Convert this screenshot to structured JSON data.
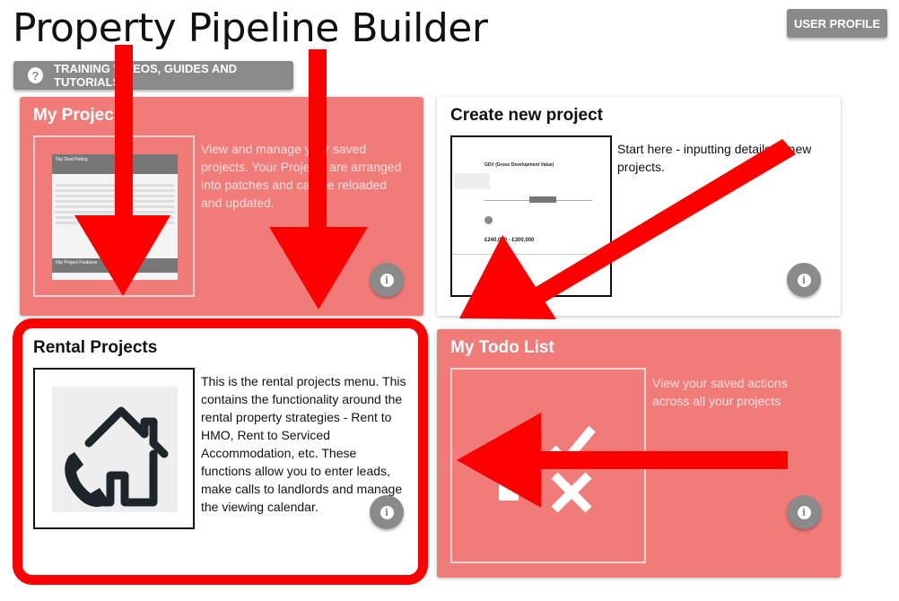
{
  "header": {
    "title": "Property Pipeline Builder",
    "user_profile_label": "USER PROFILE",
    "training_label": "TRAINING VIDEOS, GUIDES AND TUTORIALS",
    "help_glyph": "?"
  },
  "cards": {
    "my_projects": {
      "title": "My Projects",
      "description": "View and manage your saved projects. Your Projects are arranged into patches and can be reloaded and updated.",
      "thumb_heading": "Flip Deal Rating",
      "thumb_footer": "Flip Project Features"
    },
    "create_project": {
      "title": "Create new project",
      "description": "Start here - inputting details of new projects.",
      "thumb_heading": "GDV (Gross Development Value)",
      "thumb_value": "£240,000 - £300,000"
    },
    "rental_projects": {
      "title": "Rental Projects",
      "description": "This is the rental projects menu. This contains the functionality around the rental property strategies - Rent to HMO, Rent to Serviced Accommodation, etc. These functions allow you to enter leads, make calls to landlords and manage the viewing calendar."
    },
    "todo_list": {
      "title": "My Todo List",
      "description": "View your saved actions across all your projects"
    }
  },
  "info_glyph": "i",
  "colors": {
    "card_red": "#f07b78",
    "button_grey": "#8a8a8a",
    "annotation_red": "#ff0000"
  },
  "icons": [
    "help-icon",
    "info-icon",
    "house-phone-icon",
    "checklist-icon"
  ]
}
